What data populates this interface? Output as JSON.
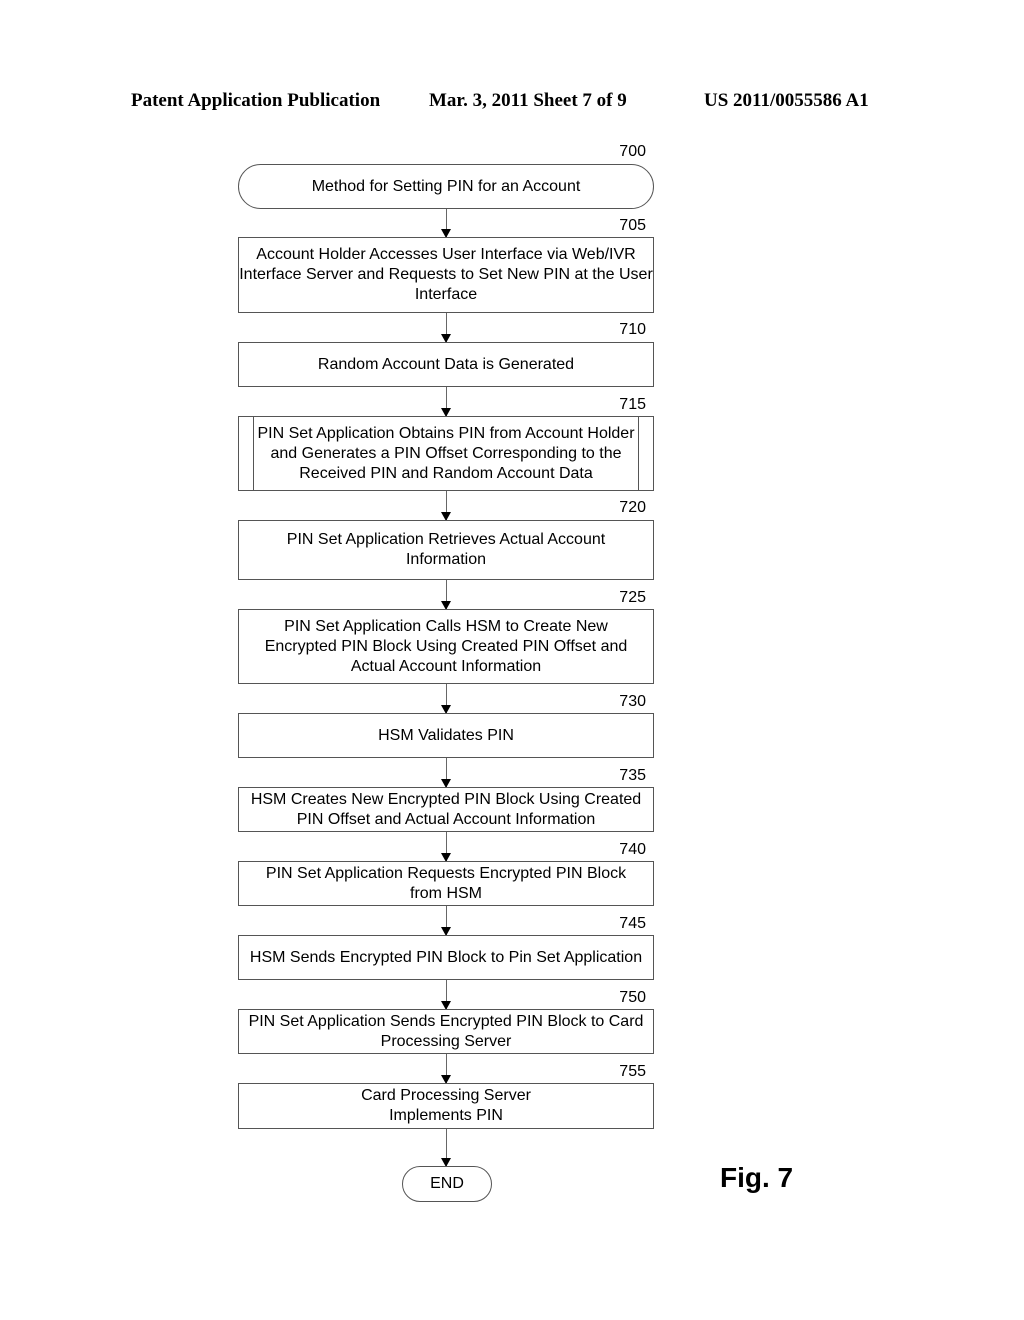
{
  "header": {
    "left": "Patent Application Publication",
    "middle": "Mar. 3, 2011   Sheet 7 of 9",
    "right": "US 2011/0055586 A1"
  },
  "nodes": [
    {
      "ref": "700",
      "text": "Method for Setting PIN for an Account"
    },
    {
      "ref": "705",
      "text": "Account Holder Accesses User Interface via Web/IVR Interface Server and Requests to Set New PIN at the User Interface"
    },
    {
      "ref": "710",
      "text": "Random Account Data is Generated"
    },
    {
      "ref": "715",
      "text": "PIN Set Application Obtains PIN from Account Holder and Generates a PIN Offset Corresponding to the Received PIN and Random Account Data"
    },
    {
      "ref": "720",
      "text": "PIN Set Application Retrieves Actual Account Information"
    },
    {
      "ref": "725",
      "text": "PIN Set Application Calls HSM to Create New Encrypted PIN Block Using Created PIN Offset and Actual Account Information"
    },
    {
      "ref": "730",
      "text": "HSM Validates PIN"
    },
    {
      "ref": "735",
      "text": "HSM Creates New Encrypted PIN Block Using Created PIN Offset and Actual Account Information"
    },
    {
      "ref": "740",
      "text": "PIN Set Application Requests Encrypted PIN Block from HSM"
    },
    {
      "ref": "745",
      "text": "HSM Sends Encrypted PIN Block to Pin Set Application"
    },
    {
      "ref": "750",
      "text": "PIN Set Application Sends Encrypted PIN Block to Card Processing Server"
    },
    {
      "ref": "755",
      "text": "Card Processing Server Implements PIN"
    }
  ],
  "end": "END",
  "figure_label": "Fig. 7"
}
